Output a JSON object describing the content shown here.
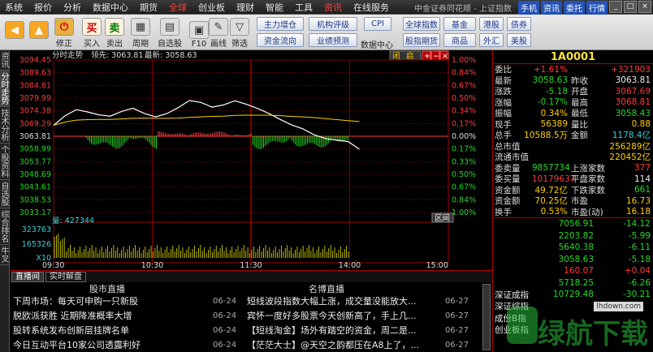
{
  "menubar": {
    "items": [
      "系统",
      "报价",
      "分析",
      "数据中心",
      "期货",
      "全球",
      "创业板",
      "理财",
      "智能",
      "工具",
      "资讯",
      "在线服务"
    ],
    "active_index": 5,
    "highlight_index": 10,
    "title": "中金证券同花顺 - 上证指数",
    "buttons": [
      "手机",
      "资讯",
      "委托",
      "行情"
    ]
  },
  "toolbar": {
    "buttons": [
      {
        "label": "",
        "icon": "back-arrow-icon"
      },
      {
        "label": "",
        "icon": "up-down-icon"
      },
      {
        "label": "修正",
        "icon": "power-icon"
      },
      {
        "label": "买入",
        "icon": "buy-icon",
        "glyph": "买"
      },
      {
        "label": "卖出",
        "icon": "sell-icon",
        "glyph": "卖"
      },
      {
        "label": "周期",
        "icon": "period-icon"
      },
      {
        "label": "自选股",
        "icon": "watchlist-icon"
      },
      {
        "label": "F10",
        "icon": "f10-icon"
      },
      {
        "label": "画线",
        "icon": "draw-line-icon"
      },
      {
        "label": "筛选",
        "icon": "filter-icon"
      }
    ],
    "pills": [
      "主力增仓",
      "机构评级",
      "资金流向",
      "业绩预测",
      "全球指数",
      "基金",
      "港股",
      "债券",
      "股指期货",
      "商品",
      "外汇",
      "美股"
    ],
    "cpi_label": "CPI",
    "data_center_label": "数据中心"
  },
  "left_tabs": [
    "资讯",
    "分时走势",
    "技术分析",
    "个股资料",
    "自选股",
    "综合排名",
    "牛叉"
  ],
  "chart": {
    "header_title": "分时走势",
    "header_lead": "领先: 3063.81",
    "header_latest": "最新: 3058.63",
    "close_label": "闭",
    "restore_label": "启",
    "y_labels": [
      "3094.45",
      "3089.63",
      "3084.81",
      "3079.99",
      "3074.38",
      "3069.29",
      "3063.81",
      "3058.99",
      "3053.77",
      "3048.69",
      "3043.61",
      "3038.53",
      "3033.17"
    ],
    "pct_labels": [
      "1.00%",
      "0.84%",
      "0.67%",
      "0.50%",
      "0.34%",
      "0.17%",
      "0.00%",
      "0.17%",
      "0.33%",
      "0.50%",
      "0.67%",
      "0.84%",
      "1.00%"
    ],
    "x_labels": [
      "09:30",
      "10:30",
      "11:30",
      "14:00",
      "15:00"
    ],
    "vol_y_labels": [
      "323763",
      "165326",
      "X10"
    ],
    "vol_label": "量: 427344",
    "interval_label": "区间",
    "chart_data": {
      "type": "line",
      "x": [
        "09:30",
        "10:30",
        "11:30",
        "14:00",
        "15:00"
      ],
      "ylim": [
        3033.17,
        3094.45
      ],
      "baseline": 3063.81,
      "series": [
        {
          "values": [
            3068.2,
            3072.0,
            3074.5,
            3073.6,
            3072.4,
            3071.9,
            3073.8,
            3075.1,
            3073.0,
            3071.6,
            3072.9,
            3075.3,
            3078.2,
            3077.4,
            3075.5,
            3076.4,
            3078.1,
            3076.7,
            3075.0,
            3073.0,
            3070.6,
            3068.4,
            3066.8,
            3064.4,
            3062.9,
            3062.2,
            3061.7,
            3058.6
          ]
        },
        {
          "values": [
            3068.2,
            3069.5,
            3070.3,
            3070.5,
            3070.6,
            3070.6,
            3070.8,
            3071.0,
            3071.1,
            3071.0,
            3071.0,
            3071.1,
            3071.4,
            3071.6,
            3071.8,
            3071.9,
            3072.2,
            3072.3,
            3072.3,
            3072.3,
            3072.1,
            3071.8,
            3071.6,
            3071.3,
            3070.9,
            3070.5,
            3070.1,
            3069.7
          ]
        }
      ]
    }
  },
  "quote": {
    "code": "1A0001",
    "rows": [
      {
        "l1": "委比",
        "v1": "+1.61%",
        "l2": "",
        "v2": "+321903",
        "c1": "red",
        "c2": "red"
      },
      {
        "l1": "最新",
        "v1": "3058.63",
        "l2": "昨收",
        "v2": "3063.81",
        "c1": "green",
        "c2": "white"
      },
      {
        "l1": "涨跌",
        "v1": "-5.18",
        "l2": "开盘",
        "v2": "3067.69",
        "c1": "green",
        "c2": "red"
      },
      {
        "l1": "涨幅",
        "v1": "-0.17%",
        "l2": "最高",
        "v2": "3068.81",
        "c1": "green",
        "c2": "red"
      },
      {
        "l1": "振幅",
        "v1": "0.34%",
        "l2": "最低",
        "v2": "3058.43",
        "c1": "yellow",
        "c2": "green"
      },
      {
        "l1": "现手",
        "v1": "56389",
        "l2": "量比",
        "v2": "0.88",
        "c1": "yellow",
        "c2": "yellow"
      },
      {
        "l1": "总手",
        "v1": "10588.5万",
        "l2": "金额",
        "v2": "1178.4亿",
        "c1": "yellow",
        "c2": "cyan"
      },
      {
        "l1": "总市值",
        "v1": "",
        "l2": "",
        "v2": "256289亿",
        "c1": "white",
        "c2": "yellow"
      },
      {
        "l1": "流通市值",
        "v1": "",
        "l2": "",
        "v2": "220452亿",
        "c1": "white",
        "c2": "yellow"
      },
      {
        "l1": "委卖量",
        "v1": "9857734",
        "l2": "上涨家数",
        "v2": "377",
        "c1": "green",
        "c2": "red"
      },
      {
        "l1": "委买量",
        "v1": "10179637",
        "l2": "平盘家数",
        "v2": "114",
        "c1": "red",
        "c2": "white"
      },
      {
        "l1": "资金额",
        "v1": "49.72亿",
        "l2": "下跌家数",
        "v2": "661",
        "c1": "yellow",
        "c2": "green"
      },
      {
        "l1": "资金额",
        "v1": "70.25亿",
        "l2": "市盈",
        "v2": "16.73",
        "c1": "yellow",
        "c2": "yellow"
      },
      {
        "l1": "换手",
        "v1": "0.53%",
        "l2": "市盈(动)",
        "v2": "16.18",
        "c1": "yellow",
        "c2": "yellow"
      }
    ],
    "indices": [
      {
        "name": "",
        "value": "7056.91",
        "change": "-14.12"
      },
      {
        "name": "",
        "value": "2203.82",
        "change": "-5.99"
      },
      {
        "name": "",
        "value": "5640.38",
        "change": "-6.11"
      },
      {
        "name": "",
        "value": "3058.63",
        "change": "-5.18"
      },
      {
        "name": "",
        "value": "160.07",
        "change": "+0.04"
      },
      {
        "name": "",
        "value": "5718.25",
        "change": "-6.26"
      },
      {
        "name": "深证成指",
        "value": "10729.48",
        "change": "-30.21"
      },
      {
        "name": "深证综指",
        "value": "",
        "change": ""
      },
      {
        "name": "成份B指",
        "value": "",
        "change": ""
      },
      {
        "name": "创业板指",
        "value": "",
        "change": ""
      }
    ]
  },
  "news": {
    "tabs": [
      "直播间",
      "实时解盘"
    ],
    "col1_header": "股市直播",
    "col2_header": "名博直播",
    "rows": [
      {
        "t1": "下周市场：每天可申购一只新股",
        "d1": "06-24",
        "t2": "短线波段指数大幅上涨，成交量没能放大...",
        "d2": "06-27"
      },
      {
        "t1": "脱欧派获胜 近期降准概率大增",
        "d1": "06-24",
        "t2": "宾怀一度好多股票今天创新高了，手上几...",
        "d2": "06-27"
      },
      {
        "t1": "股转系统发布创新层挂牌名单",
        "d1": "06-24",
        "t2": "【短线淘金】场外有踏空的资金，周二是...",
        "d2": "06-27"
      },
      {
        "t1": "今日互动平台10家公司透露利好",
        "d1": "06-24",
        "t2": "【茫茫大士】@天空之韵都压在A8上了，...",
        "d2": "06-27"
      }
    ]
  },
  "watermark": {
    "text": "绿航下载",
    "url": "lhdown.com"
  }
}
